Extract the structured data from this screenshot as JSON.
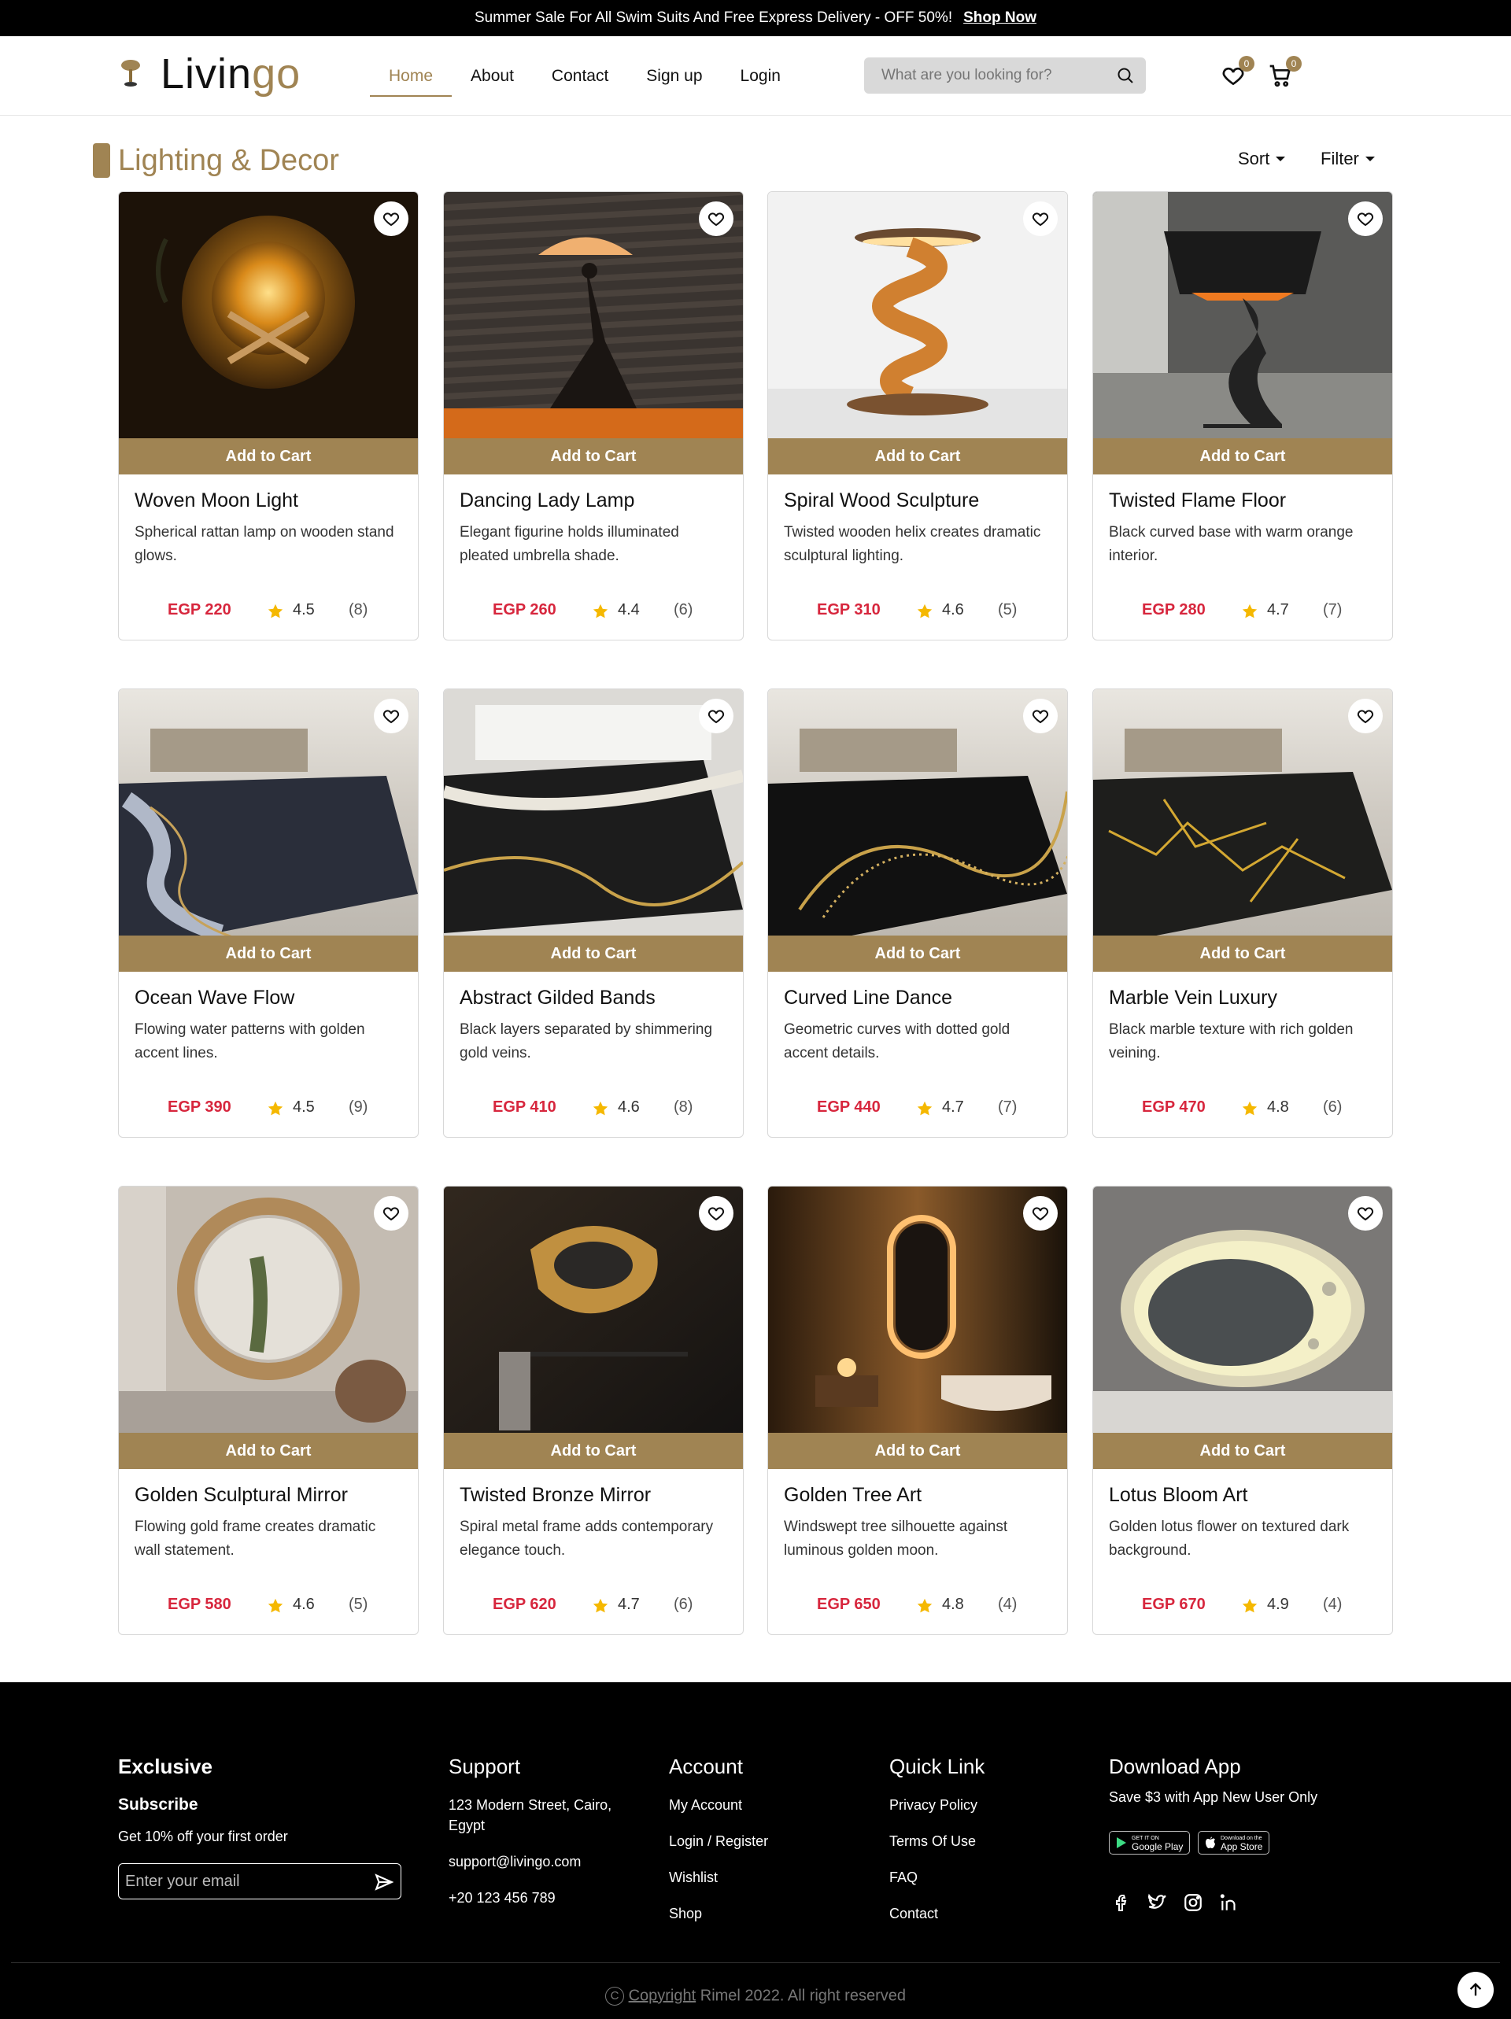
{
  "topbar": {
    "text": "Summer Sale For All Swim Suits And Free Express Delivery - OFF 50%!",
    "link": "Shop Now"
  },
  "header": {
    "logo_main": "Livin",
    "logo_accent": "go",
    "nav": [
      {
        "label": "Home",
        "active": true
      },
      {
        "label": "About"
      },
      {
        "label": "Contact"
      },
      {
        "label": "Sign up"
      },
      {
        "label": "Login"
      }
    ],
    "search_placeholder": "What are you looking for?",
    "wishlist_count": "0",
    "cart_count": "0",
    "icons": [
      "search-icon",
      "heart-icon",
      "cart-icon"
    ]
  },
  "category": {
    "title": "Lighting & Decor",
    "sort": "Sort",
    "filter": "Filter"
  },
  "add_to_cart": "Add to Cart",
  "products": [
    {
      "name": "Woven Moon Light",
      "desc": "Spherical rattan lamp on wooden stand glows.",
      "price": "EGP 220",
      "rating": "4.5",
      "count": "(8)"
    },
    {
      "name": "Dancing Lady Lamp",
      "desc": "Elegant figurine holds illuminated pleated umbrella shade.",
      "price": "EGP 260",
      "rating": "4.4",
      "count": "(6)"
    },
    {
      "name": "Spiral Wood Sculpture",
      "desc": "Twisted wooden helix creates dramatic sculptural lighting.",
      "price": "EGP 310",
      "rating": "4.6",
      "count": "(5)"
    },
    {
      "name": "Twisted Flame Floor",
      "desc": "Black curved base with warm orange interior.",
      "price": "EGP 280",
      "rating": "4.7",
      "count": "(7)"
    },
    {
      "name": "Ocean Wave Flow",
      "desc": "Flowing water patterns with golden accent lines.",
      "price": "EGP 390",
      "rating": "4.5",
      "count": "(9)"
    },
    {
      "name": "Abstract Gilded Bands",
      "desc": "Black layers separated by shimmering gold veins.",
      "price": "EGP 410",
      "rating": "4.6",
      "count": "(8)"
    },
    {
      "name": "Curved Line Dance",
      "desc": "Geometric curves with dotted gold accent details.",
      "price": "EGP 440",
      "rating": "4.7",
      "count": "(7)"
    },
    {
      "name": "Marble Vein Luxury",
      "desc": "Black marble texture with rich golden veining.",
      "price": "EGP 470",
      "rating": "4.8",
      "count": "(6)"
    },
    {
      "name": "Golden Sculptural Mirror",
      "desc": "Flowing gold frame creates dramatic wall statement.",
      "price": "EGP 580",
      "rating": "4.6",
      "count": "(5)"
    },
    {
      "name": "Twisted Bronze Mirror",
      "desc": "Spiral metal frame adds contemporary elegance touch.",
      "price": "EGP 620",
      "rating": "4.7",
      "count": "(6)"
    },
    {
      "name": "Golden Tree Art",
      "desc": "Windswept tree silhouette against luminous golden moon.",
      "price": "EGP 650",
      "rating": "4.8",
      "count": "(4)"
    },
    {
      "name": "Lotus Bloom Art",
      "desc": "Golden lotus flower on textured dark background.",
      "price": "EGP 670",
      "rating": "4.9",
      "count": "(4)"
    }
  ],
  "footer": {
    "exclusive": {
      "title": "Exclusive",
      "subscribe": "Subscribe",
      "offer": "Get 10% off your first order",
      "email_placeholder": "Enter your email"
    },
    "support": {
      "title": "Support",
      "address": "123 Modern Street, Cairo, Egypt",
      "email": "support@livingo.com",
      "phone": "+20 123 456 789"
    },
    "account": {
      "title": "Account",
      "links": [
        "My Account",
        "Login / Register",
        "Wishlist",
        "Shop"
      ]
    },
    "quick": {
      "title": "Quick Link",
      "links": [
        "Privacy Policy",
        "Terms Of Use",
        "FAQ",
        "Contact"
      ]
    },
    "app": {
      "title": "Download App",
      "note": "Save $3 with App New User Only",
      "google_small": "GET IT ON",
      "google": "Google Play",
      "apple_small": "Download on the",
      "apple": "App Store"
    },
    "social": [
      "facebook-icon",
      "twitter-icon",
      "instagram-icon",
      "linkedin-icon"
    ],
    "copyright_link": "Copyright",
    "copyright_rest": " Rimel 2022. All right reserved"
  },
  "colors": {
    "accent": "#a08453",
    "price": "#d7263d",
    "star": "#f5b800"
  }
}
